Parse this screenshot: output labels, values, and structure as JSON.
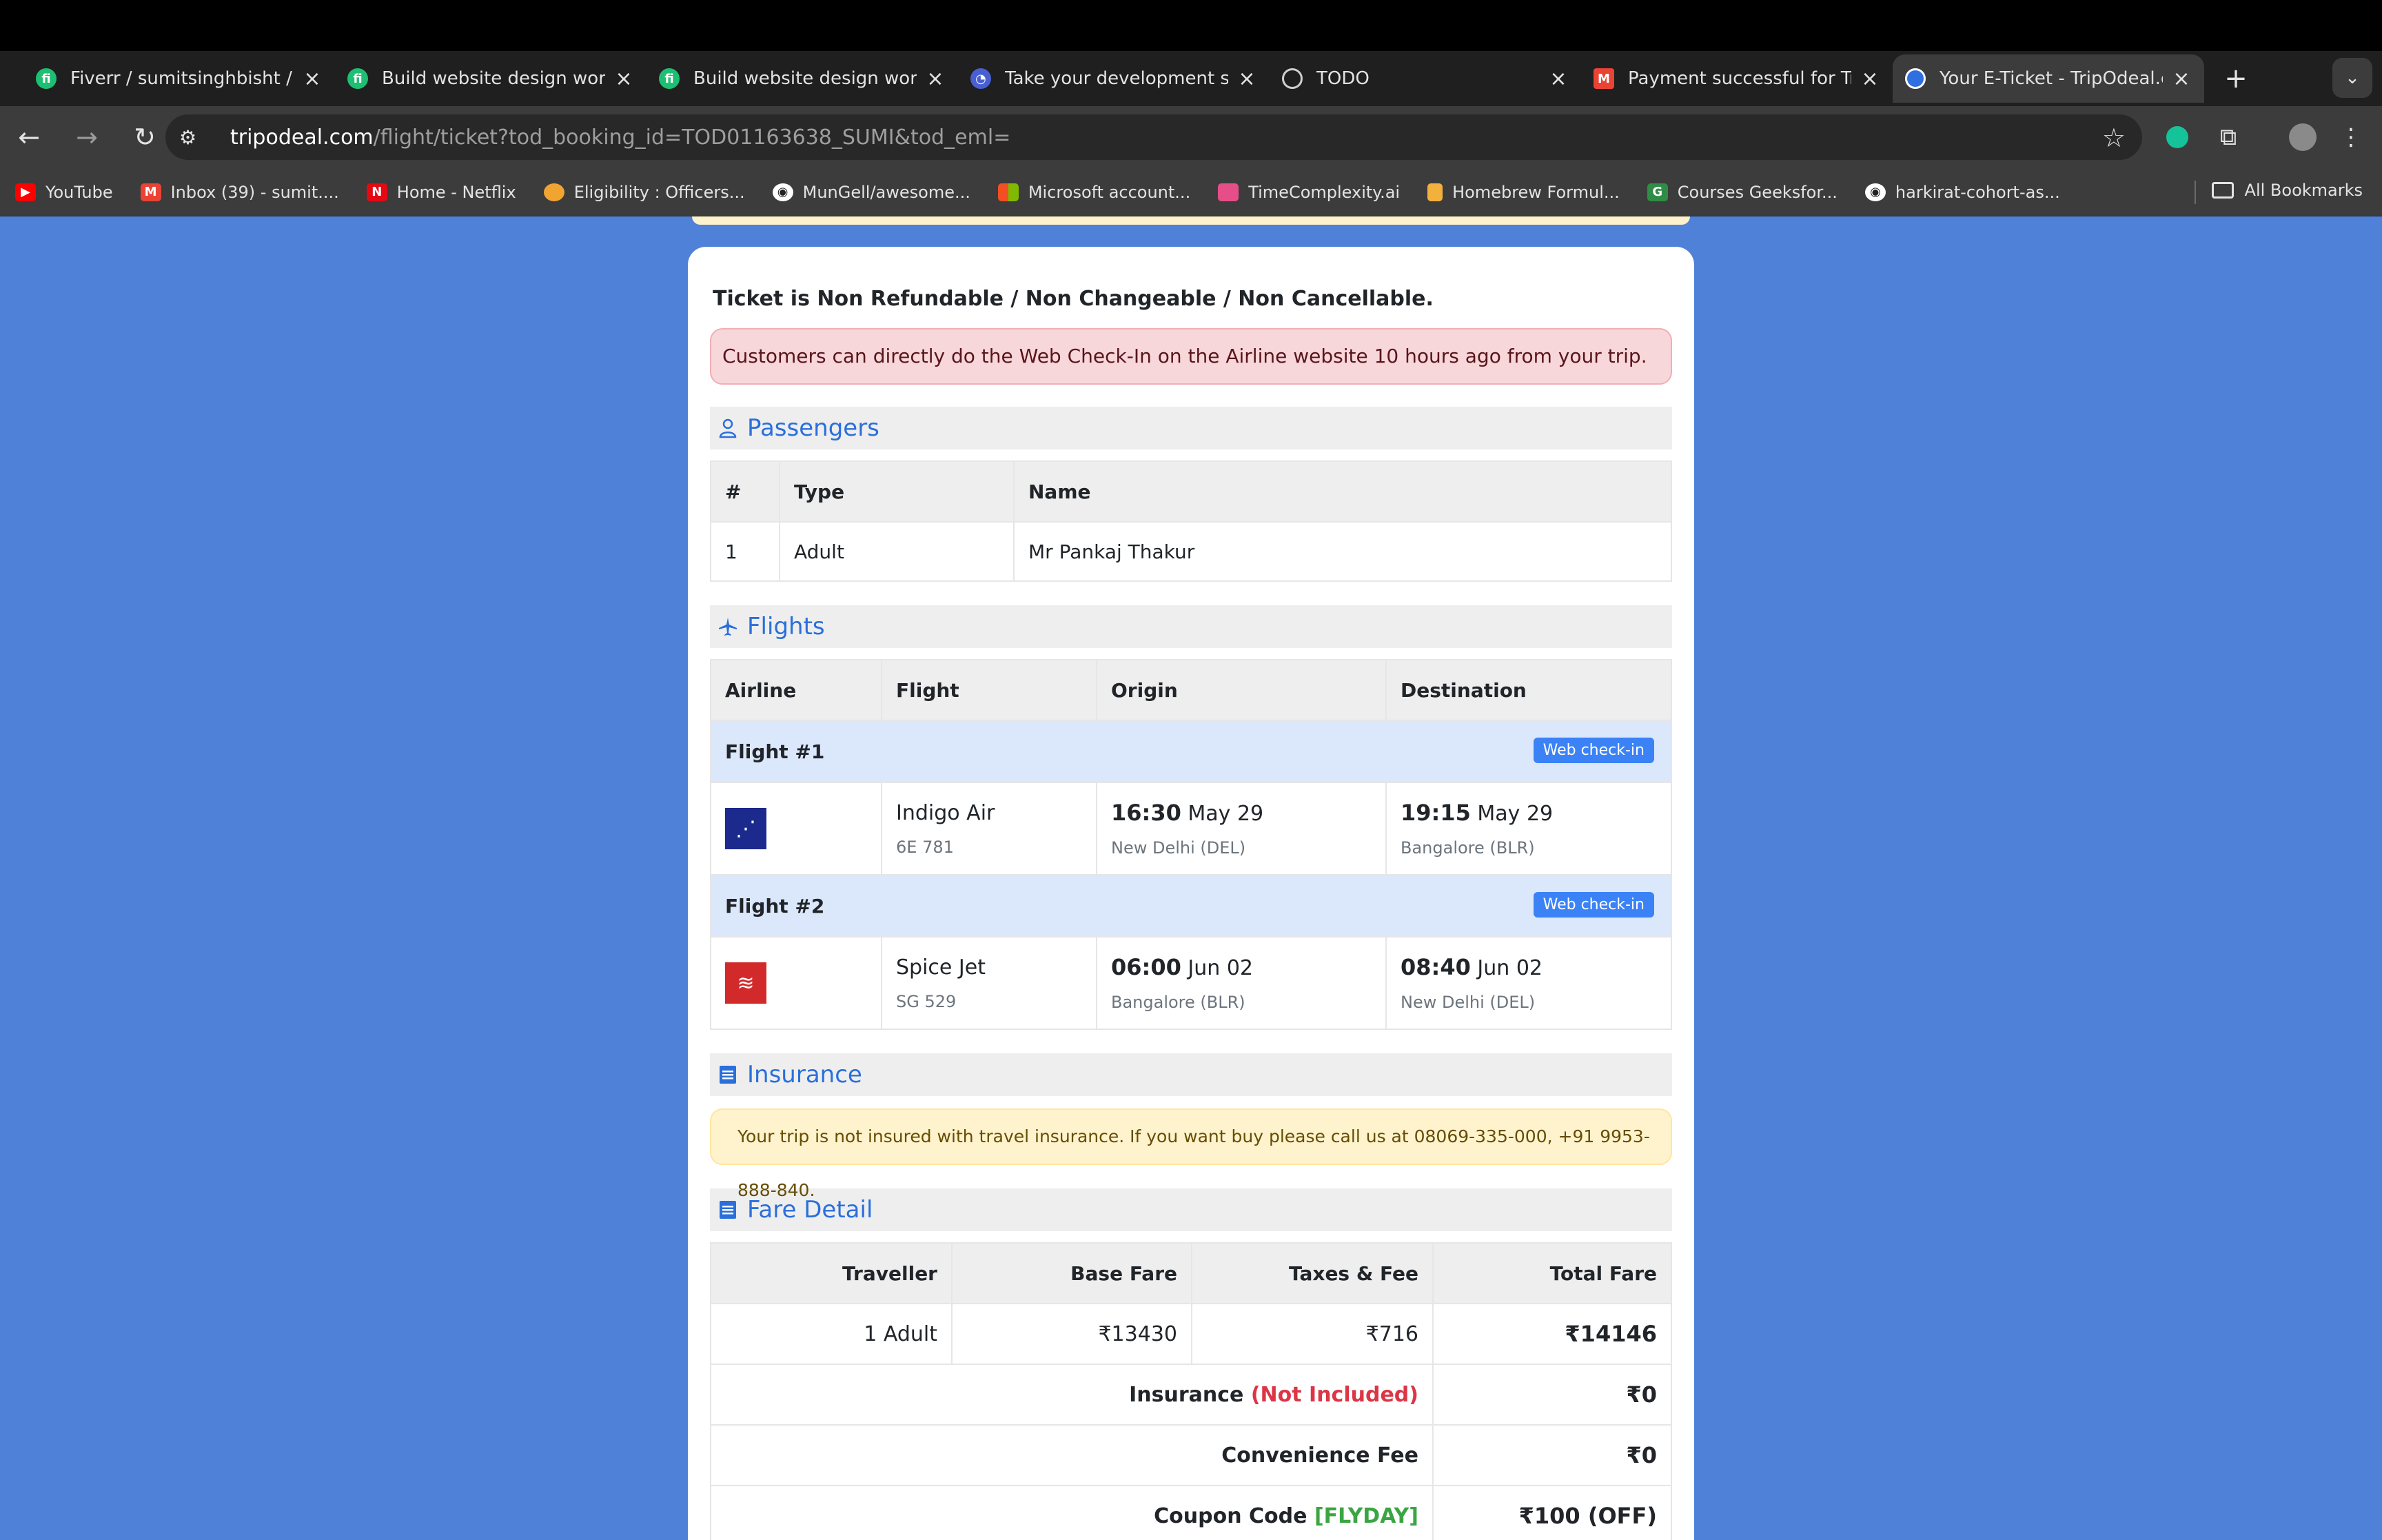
{
  "browser": {
    "tabs": [
      {
        "title": "Fiverr / sumitsinghbisht / M",
        "favicon": "fiverr-icon",
        "color": "#1dbf73",
        "active": false
      },
      {
        "title": "Build website design wordp",
        "favicon": "fiverr-icon",
        "color": "#1dbf73",
        "active": false
      },
      {
        "title": "Build website design wordp",
        "favicon": "fiverr-icon",
        "color": "#1dbf73",
        "active": false
      },
      {
        "title": "Take your development skill",
        "favicon": "course-icon",
        "color": "#4a5fd1",
        "active": false
      },
      {
        "title": "TODO",
        "favicon": "globe-icon",
        "color": "#6b6b6b",
        "active": false
      },
      {
        "title": "Payment successful for Trav",
        "favicon": "gmail-icon",
        "color": "#ea4335",
        "active": false
      },
      {
        "title": "Your E-Ticket - TripOdeal.co",
        "favicon": "tripodeal-icon",
        "color": "#2f6fe0",
        "active": true
      }
    ],
    "url_host": "tripodeal.com",
    "url_path": "/flight/ticket?tod_booking_id=TOD01163638_SUMI&tod_eml=",
    "bookmarks": [
      {
        "label": "YouTube",
        "icon": "youtube-icon",
        "color": "#ff0000"
      },
      {
        "label": "Inbox (39) - sumit....",
        "icon": "gmail-icon",
        "color": "#ea4335"
      },
      {
        "label": "Home - Netflix",
        "icon": "netflix-icon",
        "color": "#e50914"
      },
      {
        "label": "Eligibility : Officers...",
        "icon": "officers-icon",
        "color": "#f2a431"
      },
      {
        "label": "MunGell/awesome...",
        "icon": "github-icon",
        "color": "#3c3c3c"
      },
      {
        "label": "Microsoft account...",
        "icon": "microsoft-icon",
        "color": "#f25022"
      },
      {
        "label": "TimeComplexity.ai",
        "icon": "timecomplexity-icon",
        "color": "#e64e8a"
      },
      {
        "label": "Homebrew Formul...",
        "icon": "homebrew-icon",
        "color": "#f2b03c"
      },
      {
        "label": "Courses Geeksfor...",
        "icon": "geeksforgeeks-icon",
        "color": "#2f8d46"
      },
      {
        "label": "harkirat-cohort-as...",
        "icon": "github-icon",
        "color": "#3c3c3c"
      }
    ],
    "all_bookmarks": "All Bookmarks"
  },
  "ticket": {
    "policy": "Ticket is Non Refundable / Non Changeable / Non Cancellable.",
    "checkin_notice": "Customers can directly do the Web Check-In on the Airline website 10 hours ago from your trip.",
    "passengers": {
      "title": "Passengers",
      "headers": [
        "#",
        "Type",
        "Name"
      ],
      "rows": [
        [
          "1",
          "Adult",
          "Mr Pankaj Thakur"
        ]
      ]
    },
    "flights": {
      "title": "Flights",
      "headers": [
        "Airline",
        "Flight",
        "Origin",
        "Destination"
      ],
      "web_checkin_label": "Web check-in",
      "items": [
        {
          "label": "Flight #1",
          "airline_logo": "indigo-logo-icon",
          "logo_color": "#1b2a8c",
          "airline": "Indigo Air",
          "number": "6E 781",
          "dep_time": "16:30",
          "dep_date": "May 29",
          "origin": "New Delhi (DEL)",
          "arr_time": "19:15",
          "arr_date": "May 29",
          "destination": "Bangalore (BLR)"
        },
        {
          "label": "Flight #2",
          "airline_logo": "spicejet-logo-icon",
          "logo_color": "#d22a2a",
          "airline": "Spice Jet",
          "number": "SG 529",
          "dep_time": "06:00",
          "dep_date": "Jun 02",
          "origin": "Bangalore (BLR)",
          "arr_time": "08:40",
          "arr_date": "Jun 02",
          "destination": "New Delhi (DEL)"
        }
      ]
    },
    "insurance": {
      "title": "Insurance",
      "notice": "Your trip is not insured with travel insurance. If you want buy please call us at 08069-335-000, +91 9953-888-840."
    },
    "fare": {
      "title": "Fare Detail",
      "headers": [
        "Traveller",
        "Base Fare",
        "Taxes & Fee",
        "Total Fare"
      ],
      "row": [
        "1 Adult",
        "₹13430",
        "₹716",
        "₹14146"
      ],
      "insurance_label": "Insurance",
      "insurance_status": "(Not Included)",
      "insurance_value": "₹0",
      "convenience_label": "Convenience Fee",
      "convenience_value": "₹0",
      "coupon_label": "Coupon Code",
      "coupon_code": "[FLYDAY]",
      "coupon_value": "₹100 (OFF)"
    }
  }
}
